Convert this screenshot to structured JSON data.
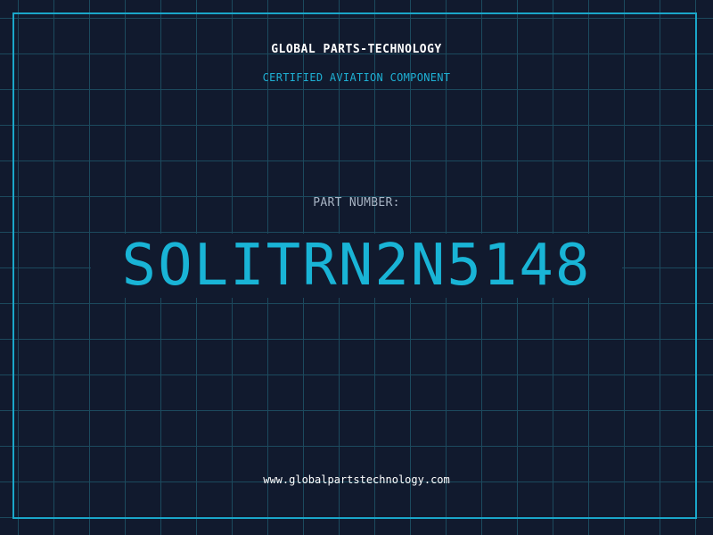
{
  "header": {
    "company": "GLOBAL PARTS-TECHNOLOGY",
    "subtitle": "CERTIFIED AVIATION COMPONENT"
  },
  "part": {
    "label": "PART NUMBER:",
    "number": "SOLITRN2N5148"
  },
  "footer": {
    "website": "www.globalpartstechnology.com"
  },
  "colors": {
    "background": "#111a2e",
    "grid": "#1c4a5e",
    "accent": "#19b4d6",
    "text": "#ffffff"
  }
}
